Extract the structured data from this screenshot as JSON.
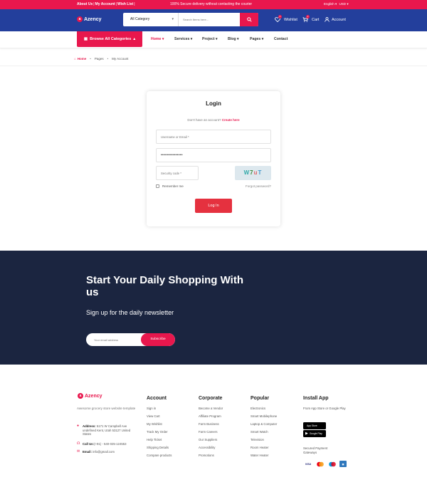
{
  "topbar": {
    "links": [
      "About Us",
      "My Account",
      "Wish List"
    ],
    "promo": "100% Secure delivery without contacting the courier",
    "language": "English",
    "currency": "USD"
  },
  "header": {
    "logo": "Azency",
    "category_select": "All Category",
    "search_placeholder": "Search Items here...",
    "wishlist_label": "Wishlist",
    "wishlist_count": "0",
    "cart_label": "Cart",
    "cart_count": "0",
    "account_label": "Account"
  },
  "nav": {
    "browse_label": "Browse All Categories",
    "items": [
      "Home",
      "Services",
      "Project",
      "Blog",
      "Pages",
      "Contact"
    ]
  },
  "breadcrumb": [
    "Home",
    "Pages",
    "My Account"
  ],
  "login": {
    "title": "Login",
    "no_account": "Don't have an account?",
    "create_link": "Create here",
    "username_placeholder": "Username or Email *",
    "password_value": "•••••••••••••••",
    "security_placeholder": "Security code *",
    "captcha": [
      "W",
      "7",
      "u",
      "T"
    ],
    "remember_label": "Remember me",
    "forgot_label": "Forgot password?",
    "submit_label": "Log In"
  },
  "newsletter": {
    "heading": "Start Your Daily Shopping With us",
    "subheading": "Sign up for the daily newsletter",
    "email_placeholder": "Your email address",
    "subscribe_label": "Subscribe"
  },
  "footer": {
    "logo": "Azency",
    "description": "Awesome grocery store website template",
    "address_label": "Address:",
    "address_value": "5171 W Campbell Ave undefined Kent, Utah 53127 United States",
    "call_label": "Call Us:",
    "call_value": "(+91) - 540-025-124553",
    "email_label": "Email:",
    "email_value": "info@gmail.com",
    "columns": [
      {
        "title": "Account",
        "links": [
          "Sign in",
          "View Cart",
          "My Wishlist",
          "Track My Order",
          "Help Ticket",
          "Shipping Details",
          "Compare products"
        ]
      },
      {
        "title": "Corporate",
        "links": [
          "Become a Vendor",
          "Affiliate Program",
          "Farm Business",
          "Farm Careers",
          "Our Suppliers",
          "Accessibility",
          "Promotions"
        ]
      },
      {
        "title": "Popular",
        "links": [
          "Electronics",
          "Smart Mobilephone",
          "Laptop & Computer",
          "Smart Watch",
          "Television",
          "Room Heater",
          "Water Heater"
        ]
      }
    ],
    "app": {
      "title": "Install App",
      "description": "From App Store or Google Play",
      "app_store": "App Store",
      "google_play": "Google Play",
      "gateways_label": "Secured Payment Gateways",
      "gateways": [
        "VISA",
        "MC",
        "Maestro",
        "AMEX"
      ]
    }
  }
}
